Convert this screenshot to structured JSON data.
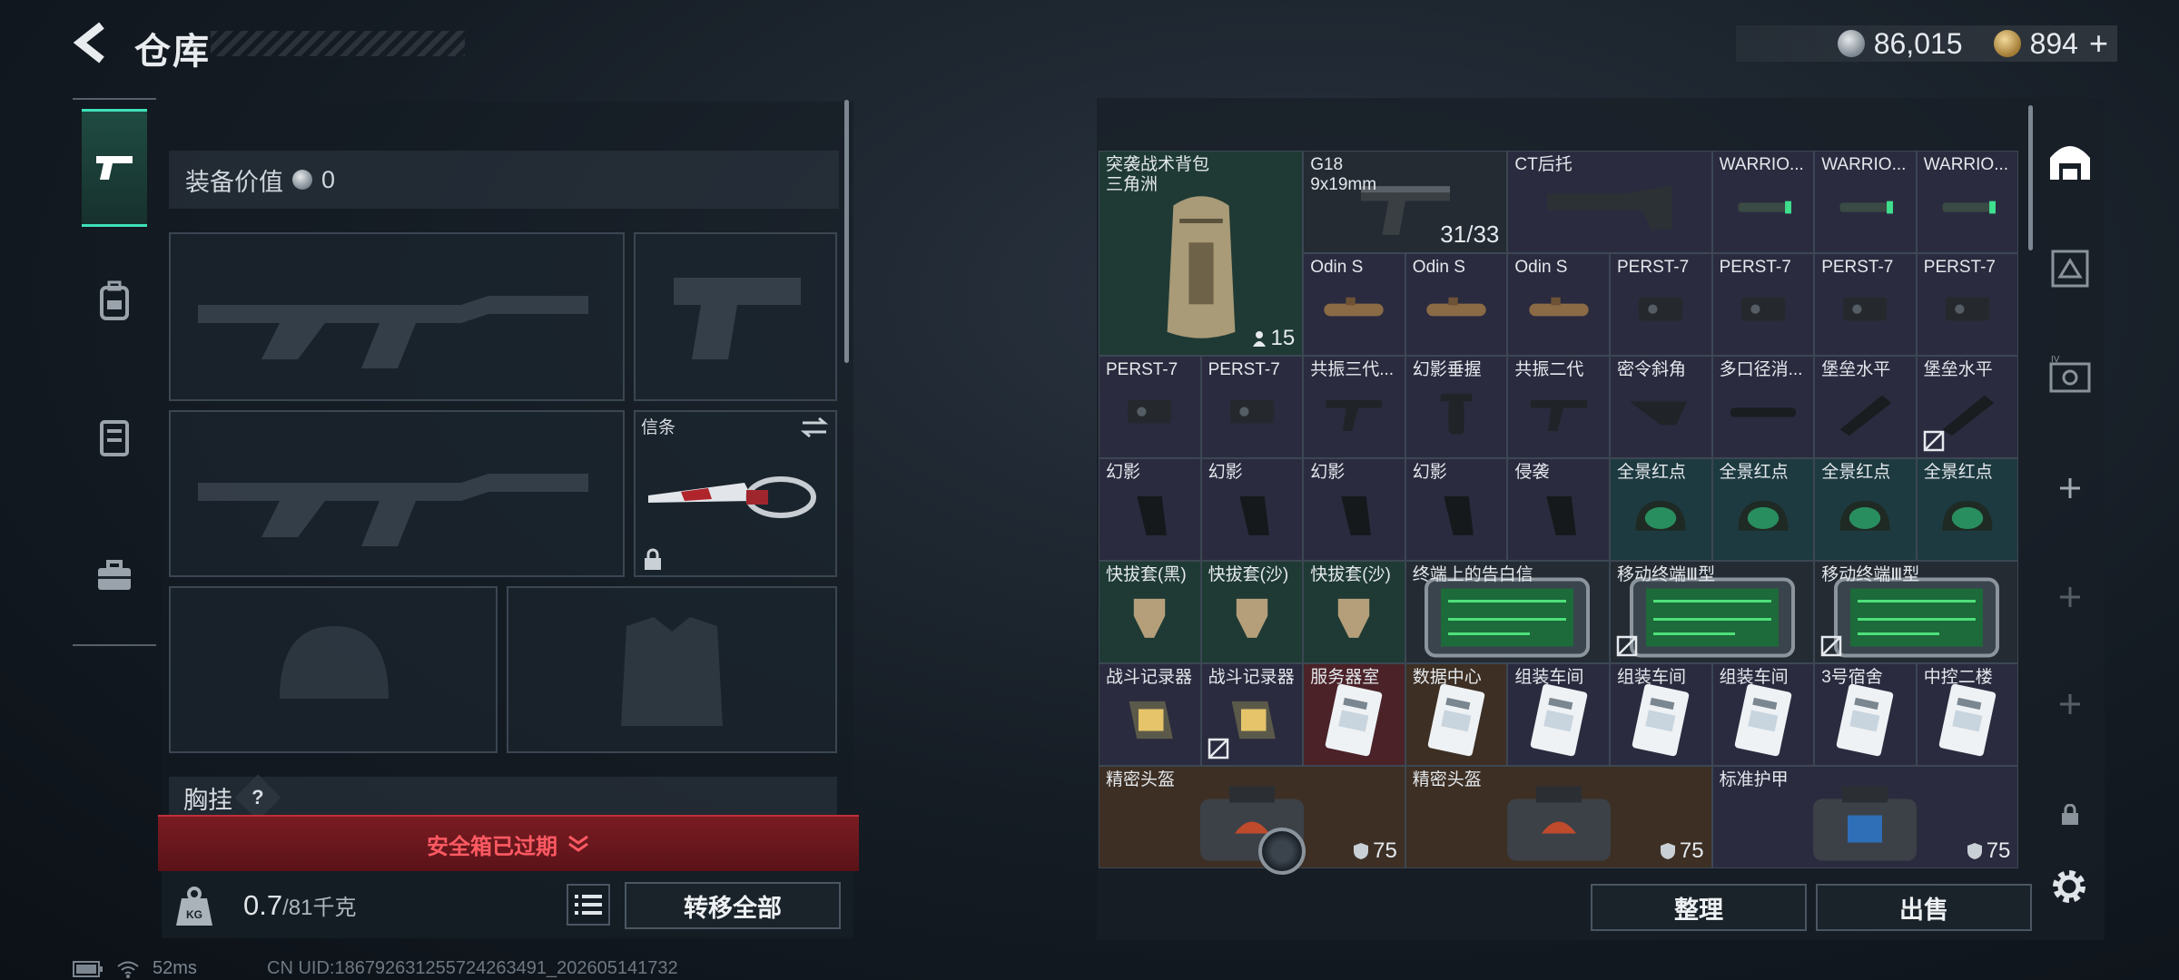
{
  "header": {
    "title": "仓库",
    "currency": {
      "silver": "86,015",
      "gold": "894",
      "add": "+"
    }
  },
  "left": {
    "equip_value_label": "装备价值",
    "equip_value": "0",
    "melee_label": "信条",
    "chest_label": "胸挂",
    "chest_help": "?",
    "safe_box_text": "安全箱已过期",
    "weight_current": "0.7",
    "weight_max": "/81千克",
    "transfer_all": "转移全部",
    "kg_tag": "KG"
  },
  "status": {
    "ping": "52ms",
    "uid": "CN UID:1867926312557242634​91_202605141732"
  },
  "grid_items": [
    {
      "label": "突袭战术背包\n三角洲",
      "icon": "backpack-icon",
      "corner": "15",
      "corner_icon": "person-icon",
      "tint": "green"
    },
    {
      "label": "G18\n9x19mm",
      "icon": "pistol-icon",
      "corner": "31/33",
      "tint": "dark"
    },
    {
      "label": "CT后托",
      "icon": "stock-icon",
      "tint": "purple"
    },
    {
      "label": "WARRIO...",
      "icon": "flashlight-icon",
      "tint": "purple"
    },
    {
      "label": "WARRIO...",
      "icon": "flashlight-icon",
      "tint": "purple"
    },
    {
      "label": "WARRIO...",
      "icon": "flashlight-icon",
      "tint": "purple"
    },
    {
      "label": "Odin S",
      "icon": "scope-icon",
      "tint": "purple"
    },
    {
      "label": "Odin S",
      "icon": "scope-icon",
      "tint": "purple"
    },
    {
      "label": "Odin S",
      "icon": "scope-icon",
      "tint": "purple"
    },
    {
      "label": "PERST-7",
      "icon": "laser-icon",
      "tint": "purple"
    },
    {
      "label": "PERST-7",
      "icon": "laser-icon",
      "tint": "purple"
    },
    {
      "label": "PERST-7",
      "icon": "laser-icon",
      "tint": "purple"
    },
    {
      "label": "PERST-7",
      "icon": "laser-icon",
      "tint": "purple"
    },
    {
      "label": "PERST-7",
      "icon": "laser-icon",
      "tint": "purple"
    },
    {
      "label": "PERST-7",
      "icon": "laser-icon",
      "tint": "purple"
    },
    {
      "label": "共振三代...",
      "icon": "grip-icon",
      "tint": "purple"
    },
    {
      "label": "幻影垂握",
      "icon": "vertical-grip-icon",
      "tint": "purple"
    },
    {
      "label": "共振二代",
      "icon": "grip-icon",
      "tint": "purple"
    },
    {
      "label": "密令斜角",
      "icon": "angled-grip-icon",
      "tint": "purple"
    },
    {
      "label": "多口径消...",
      "icon": "suppressor-icon",
      "tint": "purple"
    },
    {
      "label": "堡垒水平",
      "icon": "muzzle-icon",
      "tint": "purple"
    },
    {
      "label": "堡垒水平",
      "icon": "muzzle-icon",
      "tint": "purple"
    },
    {
      "label": "幻影",
      "icon": "pistol-grip-icon",
      "tint": "purple"
    },
    {
      "label": "幻影",
      "icon": "pistol-grip-icon",
      "tint": "purple"
    },
    {
      "label": "幻影",
      "icon": "pistol-grip-icon",
      "tint": "purple"
    },
    {
      "label": "幻影",
      "icon": "pistol-grip-icon",
      "tint": "purple"
    },
    {
      "label": "侵袭",
      "icon": "pistol-grip-icon",
      "tint": "purple"
    },
    {
      "label": "全景红点",
      "icon": "red-dot-icon",
      "tint": "teal"
    },
    {
      "label": "全景红点",
      "icon": "red-dot-icon",
      "tint": "teal"
    },
    {
      "label": "全景红点",
      "icon": "red-dot-icon",
      "tint": "teal"
    },
    {
      "label": "全景红点",
      "icon": "red-dot-icon",
      "tint": "teal"
    },
    {
      "label": "快拔套(黑)",
      "icon": "holster-icon",
      "tint": "green"
    },
    {
      "label": "快拔套(沙)",
      "icon": "holster-icon",
      "tint": "green"
    },
    {
      "label": "快拔套(沙)",
      "icon": "holster-icon",
      "tint": "green"
    },
    {
      "label": "终端上的告白信",
      "icon": "tablet-icon",
      "tint": "dark"
    },
    {
      "label": "移动终端Ⅲ型",
      "icon": "tablet-icon",
      "tint": "dark"
    },
    {
      "label": "移动终端Ⅲ型",
      "icon": "tablet-icon",
      "tint": "dark"
    },
    {
      "label": "战斗记录器",
      "icon": "recorder-icon",
      "tint": "purple"
    },
    {
      "label": "战斗记录器",
      "icon": "recorder-icon",
      "tint": "purple"
    },
    {
      "label": "服务器室",
      "icon": "keycard-icon",
      "tint": "red"
    },
    {
      "label": "数据中心",
      "icon": "keycard-icon",
      "tint": "brown"
    },
    {
      "label": "组装车间",
      "icon": "keycard-icon",
      "tint": "purple"
    },
    {
      "label": "组装车间",
      "icon": "keycard-icon",
      "tint": "purple"
    },
    {
      "label": "组装车间",
      "icon": "keycard-icon",
      "tint": "purple"
    },
    {
      "label": "3号宿舍",
      "icon": "keycard-icon",
      "tint": "purple"
    },
    {
      "label": "中控二楼",
      "icon": "keycard-icon",
      "tint": "purple"
    },
    {
      "label": "精密头盔",
      "icon": "helmet-case-icon",
      "corner": "75",
      "tint": "brown"
    },
    {
      "label": "精密头盔",
      "icon": "helmet-case-icon",
      "corner": "75",
      "tint": "brown"
    },
    {
      "label": "标准护甲",
      "icon": "armor-case-icon",
      "corner": "75",
      "tint": "purple"
    }
  ],
  "buttons": {
    "sort": "整理",
    "sell": "出售"
  },
  "colors": {
    "accent": "#3fe0b8",
    "danger": "#ff5a63",
    "tint_purple": "#2b2b3f",
    "tint_green": "#1f3a34",
    "tint_teal": "#1d3a40",
    "tint_red": "#4a2228",
    "tint_brown": "#3d2f24",
    "tint_dark": "#242b33"
  }
}
